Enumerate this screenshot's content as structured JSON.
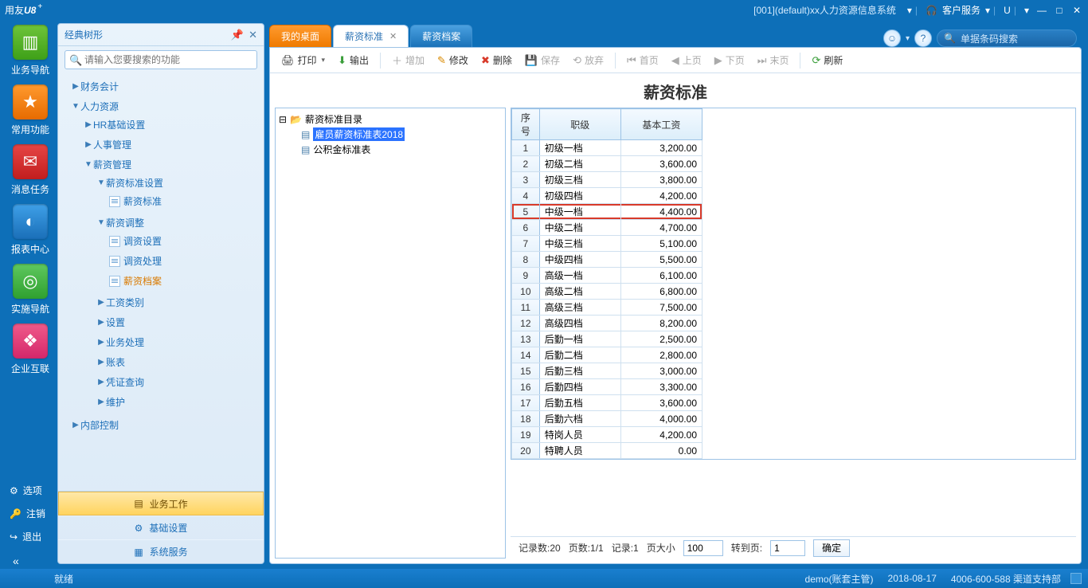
{
  "titlebar": {
    "logo_prefix": "用友",
    "logo_brand": "U8",
    "logo_plus": "+",
    "system_info": "[001](default)xx人力资源信息系统",
    "dropdown_caret": "▾",
    "customer_service": "客户服务",
    "u_btn": "U"
  },
  "rail": {
    "items": [
      {
        "label": "业务导航",
        "icon": "◧",
        "name": "nav-business"
      },
      {
        "label": "常用功能",
        "icon": "★",
        "name": "nav-common"
      },
      {
        "label": "消息任务",
        "icon": "✉",
        "name": "nav-message"
      },
      {
        "label": "报表中心",
        "icon": "◐",
        "name": "nav-report"
      },
      {
        "label": "实施导航",
        "icon": "◎",
        "name": "nav-impl"
      },
      {
        "label": "企业互联",
        "icon": "❖",
        "name": "nav-enterprise"
      }
    ],
    "bottom": [
      {
        "label": "选项",
        "icon": "⚙",
        "name": "opt"
      },
      {
        "label": "注销",
        "icon": "🔑",
        "name": "logout"
      },
      {
        "label": "退出",
        "icon": "↩",
        "name": "exit"
      }
    ]
  },
  "sidebar": {
    "title": "经典树形",
    "search_placeholder": "请输入您要搜索的功能",
    "tree": {
      "n0": {
        "label": "财务会计"
      },
      "n1": {
        "label": "人力资源"
      },
      "n2": {
        "label": "HR基础设置"
      },
      "n3": {
        "label": "人事管理"
      },
      "n4": {
        "label": "薪资管理"
      },
      "n5": {
        "label": "薪资标准设置"
      },
      "n6": {
        "label": "薪资标准"
      },
      "n7": {
        "label": "薪资调整"
      },
      "n8": {
        "label": "调资设置"
      },
      "n9": {
        "label": "调资处理"
      },
      "n10": {
        "label": "薪资档案"
      },
      "n11": {
        "label": "工资类别"
      },
      "n12": {
        "label": "设置"
      },
      "n13": {
        "label": "业务处理"
      },
      "n14": {
        "label": "账表"
      },
      "n15": {
        "label": "凭证查询"
      },
      "n16": {
        "label": "维护"
      },
      "n17": {
        "label": "内部控制"
      }
    },
    "bottom": {
      "b0": "业务工作",
      "b1": "基础设置",
      "b2": "系统服务"
    }
  },
  "tabs": {
    "t0": "我的桌面",
    "t1": "薪资标准",
    "t2": "薪资档案",
    "search_placeholder": "单据条码搜索"
  },
  "toolbar": {
    "print": "打印",
    "output": "输出",
    "add": "增加",
    "edit": "修改",
    "delete": "删除",
    "save": "保存",
    "abandon": "放弃",
    "first": "首页",
    "prev": "上页",
    "next": "下页",
    "last": "末页",
    "refresh": "刷新"
  },
  "page": {
    "title": "薪资标准",
    "dir_root": "薪资标准目录",
    "dir_item1": "雇员薪资标准表2018",
    "dir_item2": "公积金标准表"
  },
  "grid": {
    "headers": {
      "seq": "序号",
      "level": "职级",
      "base": "基本工资"
    },
    "rows": [
      {
        "seq": 1,
        "level": "初级一档",
        "base": "3,200.00"
      },
      {
        "seq": 2,
        "level": "初级二档",
        "base": "3,600.00"
      },
      {
        "seq": 3,
        "level": "初级三档",
        "base": "3,800.00"
      },
      {
        "seq": 4,
        "level": "初级四档",
        "base": "4,200.00"
      },
      {
        "seq": 5,
        "level": "中级一档",
        "base": "4,400.00",
        "hl": true
      },
      {
        "seq": 6,
        "level": "中级二档",
        "base": "4,700.00"
      },
      {
        "seq": 7,
        "level": "中级三档",
        "base": "5,100.00"
      },
      {
        "seq": 8,
        "level": "中级四档",
        "base": "5,500.00"
      },
      {
        "seq": 9,
        "level": "高级一档",
        "base": "6,100.00"
      },
      {
        "seq": 10,
        "level": "高级二档",
        "base": "6,800.00"
      },
      {
        "seq": 11,
        "level": "高级三档",
        "base": "7,500.00"
      },
      {
        "seq": 12,
        "level": "高级四档",
        "base": "8,200.00"
      },
      {
        "seq": 13,
        "level": "后勤一档",
        "base": "2,500.00"
      },
      {
        "seq": 14,
        "level": "后勤二档",
        "base": "2,800.00"
      },
      {
        "seq": 15,
        "level": "后勤三档",
        "base": "3,000.00"
      },
      {
        "seq": 16,
        "level": "后勤四档",
        "base": "3,300.00"
      },
      {
        "seq": 17,
        "level": "后勤五档",
        "base": "3,600.00"
      },
      {
        "seq": 18,
        "level": "后勤六档",
        "base": "4,000.00"
      },
      {
        "seq": 19,
        "level": "特岗人员",
        "base": "4,200.00"
      },
      {
        "seq": 20,
        "level": "特聘人员",
        "base": "0.00"
      }
    ]
  },
  "pager": {
    "records": "记录数:20",
    "pages": "页数:1/1",
    "current": "记录:1",
    "pagesize_label": "页大小",
    "pagesize_value": "100",
    "goto_label": "转到页:",
    "goto_value": "1",
    "confirm": "确定"
  },
  "statusbar": {
    "ready": "就绪",
    "user": "demo(账套主管)",
    "date": "2018-08-17",
    "support": "4006-600-588 渠道支持部"
  }
}
